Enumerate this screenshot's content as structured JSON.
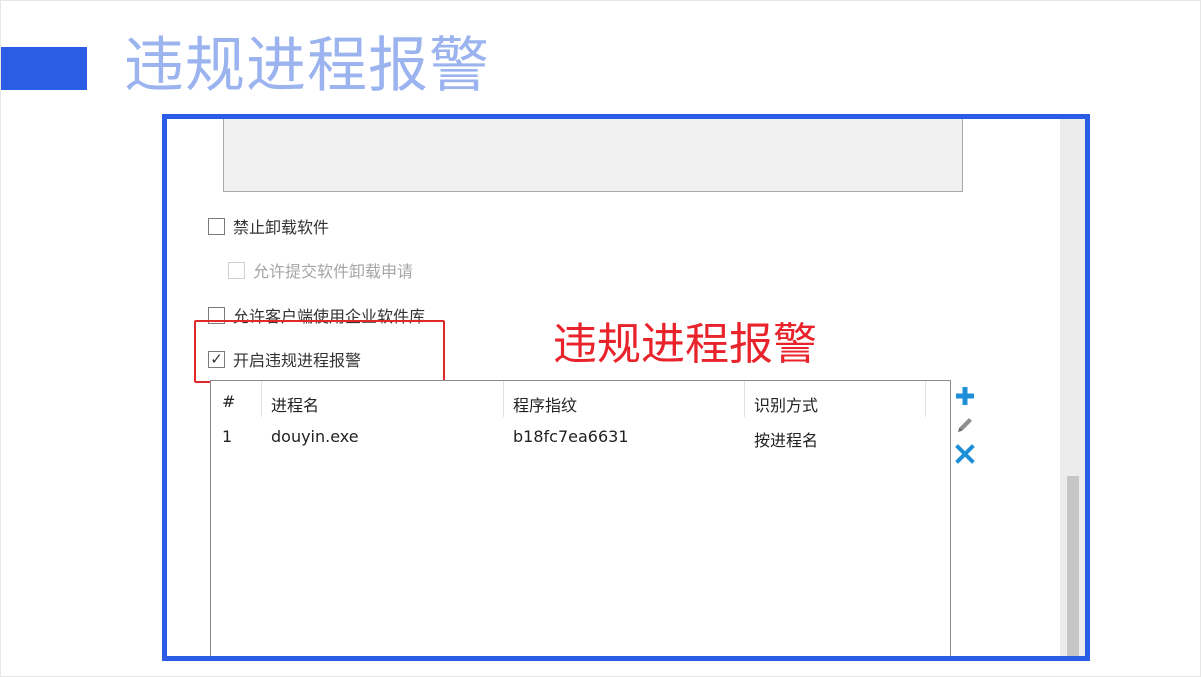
{
  "slide": {
    "title": "违规进程报警"
  },
  "settings": {
    "options": [
      {
        "label": "禁止卸载软件",
        "checked": false,
        "enabled": true
      },
      {
        "label": "允许提交软件卸载申请",
        "checked": false,
        "enabled": false
      },
      {
        "label": "允许客户端使用企业软件库",
        "checked": false,
        "enabled": true
      },
      {
        "label": "开启违规进程报警",
        "checked": true,
        "enabled": true
      }
    ],
    "check_mark": "✓"
  },
  "annotation": {
    "text": "违规进程报警",
    "color": "#e8232b"
  },
  "process_table": {
    "columns": [
      "#",
      "进程名",
      "程序指纹",
      "识别方式"
    ],
    "rows": [
      [
        "1",
        "douyin.exe",
        "b18fc7ea6631",
        "按进程名"
      ]
    ]
  },
  "toolbar": {
    "add_icon": "plus-icon",
    "edit_icon": "pencil-icon",
    "delete_icon": "close-icon"
  },
  "colors": {
    "accent_blue": "#2b5ce6",
    "title_blue": "#9bb4ef",
    "icon_blue": "#1d8fd8",
    "highlight_red": "#e02a2a"
  }
}
